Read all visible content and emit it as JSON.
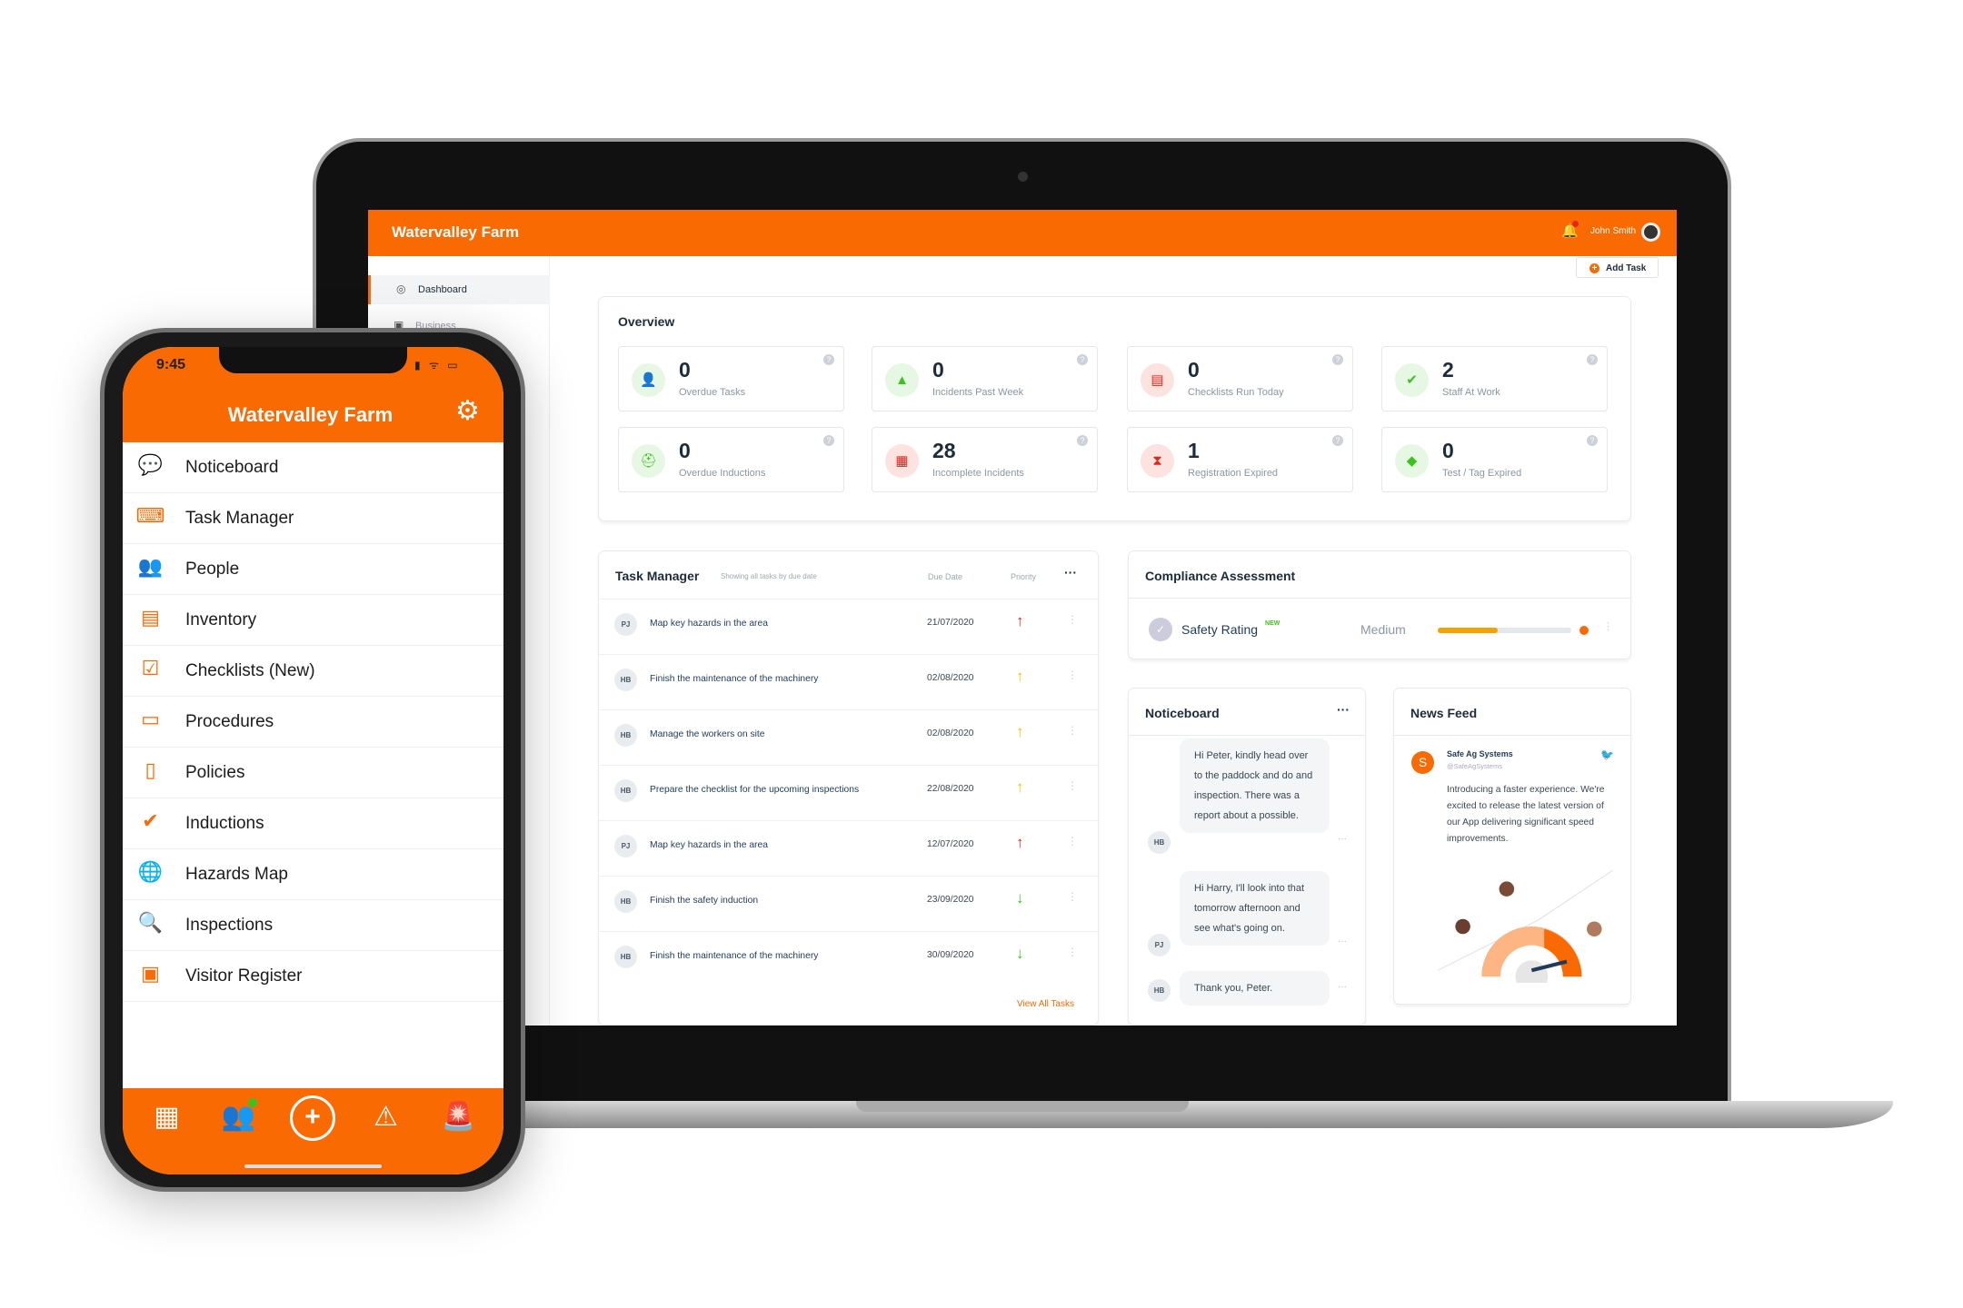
{
  "colors": {
    "brand": "#f96a02",
    "green": "#3cc21f",
    "red": "#e0261b",
    "yellow": "#f5c000"
  },
  "web": {
    "app_title": "Watervalley Farm",
    "user_name": "John Smith",
    "add_task": "Add Task",
    "sidebar": [
      {
        "label": "Dashboard",
        "icon": "dashboard-icon"
      },
      {
        "label": "Business",
        "icon": "briefcase-icon"
      }
    ],
    "overview": {
      "title": "Overview",
      "stats": [
        {
          "value": "0",
          "label": "Overdue Tasks",
          "icon": "user-clock-icon",
          "tone": "green"
        },
        {
          "value": "0",
          "label": "Incidents Past Week",
          "icon": "warning-icon",
          "tone": "green"
        },
        {
          "value": "0",
          "label": "Checklists Run Today",
          "icon": "clipboard-icon",
          "tone": "red"
        },
        {
          "value": "2",
          "label": "Staff At Work",
          "icon": "user-check-icon",
          "tone": "green"
        },
        {
          "value": "0",
          "label": "Overdue Inductions",
          "icon": "induction-icon",
          "tone": "green"
        },
        {
          "value": "28",
          "label": "Incomplete Incidents",
          "icon": "calendar-icon",
          "tone": "red"
        },
        {
          "value": "1",
          "label": "Registration Expired",
          "icon": "hourglass-icon",
          "tone": "red"
        },
        {
          "value": "0",
          "label": "Test / Tag Expired",
          "icon": "tag-icon",
          "tone": "green"
        }
      ]
    },
    "tasks": {
      "title": "Task Manager",
      "subtitle": "Showing all tasks by due date",
      "col_due": "Due Date",
      "col_priority": "Priority",
      "view_all": "View All Tasks",
      "rows": [
        {
          "initials": "PJ",
          "name": "Map key hazards in the area",
          "due": "21/07/2020",
          "priority": "high"
        },
        {
          "initials": "HB",
          "name": "Finish the maintenance of the machinery",
          "due": "02/08/2020",
          "priority": "medium"
        },
        {
          "initials": "HB",
          "name": "Manage the workers on site",
          "due": "02/08/2020",
          "priority": "medium"
        },
        {
          "initials": "HB",
          "name": "Prepare the checklist for the upcoming inspections",
          "due": "22/08/2020",
          "priority": "medium"
        },
        {
          "initials": "PJ",
          "name": "Map key hazards in the area",
          "due": "12/07/2020",
          "priority": "high"
        },
        {
          "initials": "HB",
          "name": "Finish the safety induction",
          "due": "23/09/2020",
          "priority": "low"
        },
        {
          "initials": "HB",
          "name": "Finish the maintenance of the machinery",
          "due": "30/09/2020",
          "priority": "low"
        }
      ]
    },
    "compliance": {
      "title": "Compliance Assessment",
      "label": "Safety Rating",
      "badge": "NEW",
      "level": "Medium",
      "progress_pct": 45
    },
    "noticeboard": {
      "title": "Noticeboard",
      "messages": [
        {
          "initials": "HB",
          "text": "Hi Peter, kindly head over to the paddock and do and inspection. There was a report about a possible."
        },
        {
          "initials": "PJ",
          "text": "Hi Harry, I'll look into that tomorrow afternoon and see what's going on."
        },
        {
          "initials": "HB",
          "text": "Thank you, Peter."
        }
      ]
    },
    "news": {
      "title": "News Feed",
      "author": "Safe Ag Systems",
      "handle": "@SafeAgSystems",
      "text": "Introducing a faster experience. We're excited to release the latest version of our App delivering significant speed improvements."
    }
  },
  "mobile": {
    "time": "9:45",
    "title": "Watervalley Farm",
    "menu": [
      {
        "label": "Noticeboard",
        "icon": "chat-icon"
      },
      {
        "label": "Task Manager",
        "icon": "task-icon"
      },
      {
        "label": "People",
        "icon": "people-icon"
      },
      {
        "label": "Inventory",
        "icon": "warehouse-icon"
      },
      {
        "label": "Checklists (New)",
        "icon": "checklist-icon"
      },
      {
        "label": "Procedures",
        "icon": "book-icon"
      },
      {
        "label": "Policies",
        "icon": "document-icon"
      },
      {
        "label": "Inductions",
        "icon": "check-circle-icon"
      },
      {
        "label": "Hazards Map",
        "icon": "globe-warning-icon"
      },
      {
        "label": "Inspections",
        "icon": "magnify-icon"
      },
      {
        "label": "Visitor Register",
        "icon": "id-card-icon"
      }
    ],
    "tabbar": [
      "qr-code-icon",
      "team-icon",
      "add-icon",
      "warning-icon",
      "siren-icon"
    ]
  }
}
